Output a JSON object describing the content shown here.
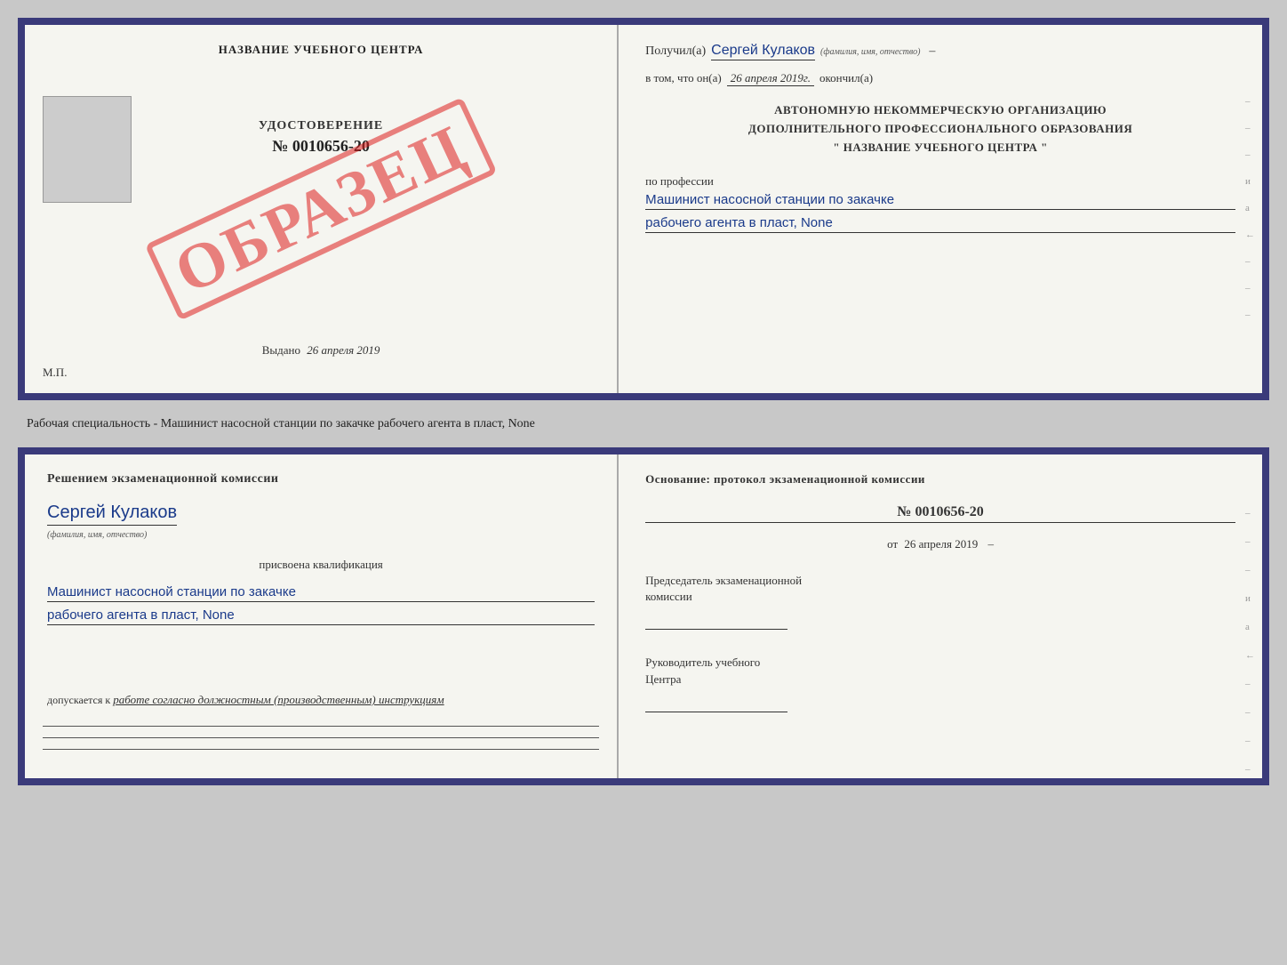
{
  "top_doc": {
    "left": {
      "center_title": "НАЗВАНИЕ УЧЕБНОГО ЦЕНТРА",
      "udostoverenie_label": "УДОСТОВЕРЕНИЕ",
      "number": "№ 0010656-20",
      "vydano_label": "Выдано",
      "vydano_date": "26 апреля 2019",
      "mp_label": "М.П.",
      "obrazets": "ОБРАЗЕЦ"
    },
    "right": {
      "poluchil_label": "Получил(а)",
      "recipient_name": "Сергей Кулаков",
      "fio_hint": "(фамилия, имя, отчество)",
      "dash": "–",
      "vtom_label": "в том, что он(а)",
      "date": "26 апреля 2019г.",
      "okonchil_label": "окончил(а)",
      "org_line1": "АВТОНОМНУЮ НЕКОММЕРЧЕСКУЮ ОРГАНИЗАЦИЮ",
      "org_line2": "ДОПОЛНИТЕЛЬНОГО ПРОФЕССИОНАЛЬНОГО ОБРАЗОВАНИЯ",
      "org_line3": "\" НАЗВАНИЕ УЧЕБНОГО ЦЕНТРА \"",
      "po_professii": "по профессии",
      "profession_line1": "Машинист насосной станции по закачке",
      "profession_line2": "рабочего агента в пласт, None",
      "side_lines": [
        "-",
        "-",
        "-",
        "и",
        "а",
        "←",
        "-",
        "-",
        "-"
      ]
    }
  },
  "middle_text": "Рабочая специальность - Машинист насосной станции по закачке рабочего агента в пласт,\nNone",
  "bottom_doc": {
    "left": {
      "komissia_title": "Решением экзаменационной комиссии",
      "name": "Сергей Кулаков",
      "fio_hint": "(фамилия, имя, отчество)",
      "prisvoena": "присвоена квалификация",
      "kvali_line1": "Машинист насосной станции по закачке",
      "kvali_line2": "рабочего агента в пласт, None",
      "dopuskaetsya_label": "допускается к",
      "dopusk_text": "работе согласно должностным (производственным) инструкциям"
    },
    "right": {
      "osnov_title": "Основание: протокол экзаменационной комиссии",
      "protocol_number": "№ 0010656-20",
      "ot_label": "от",
      "ot_date": "26 апреля 2019",
      "predsedatel_title": "Председатель экзаменационной\nкомиссии",
      "rukovoditel_title": "Руководитель учебного\nЦентра",
      "side_labels": [
        "-",
        "-",
        "-",
        "и",
        "а",
        "←",
        "-",
        "-",
        "-",
        "-"
      ]
    }
  }
}
